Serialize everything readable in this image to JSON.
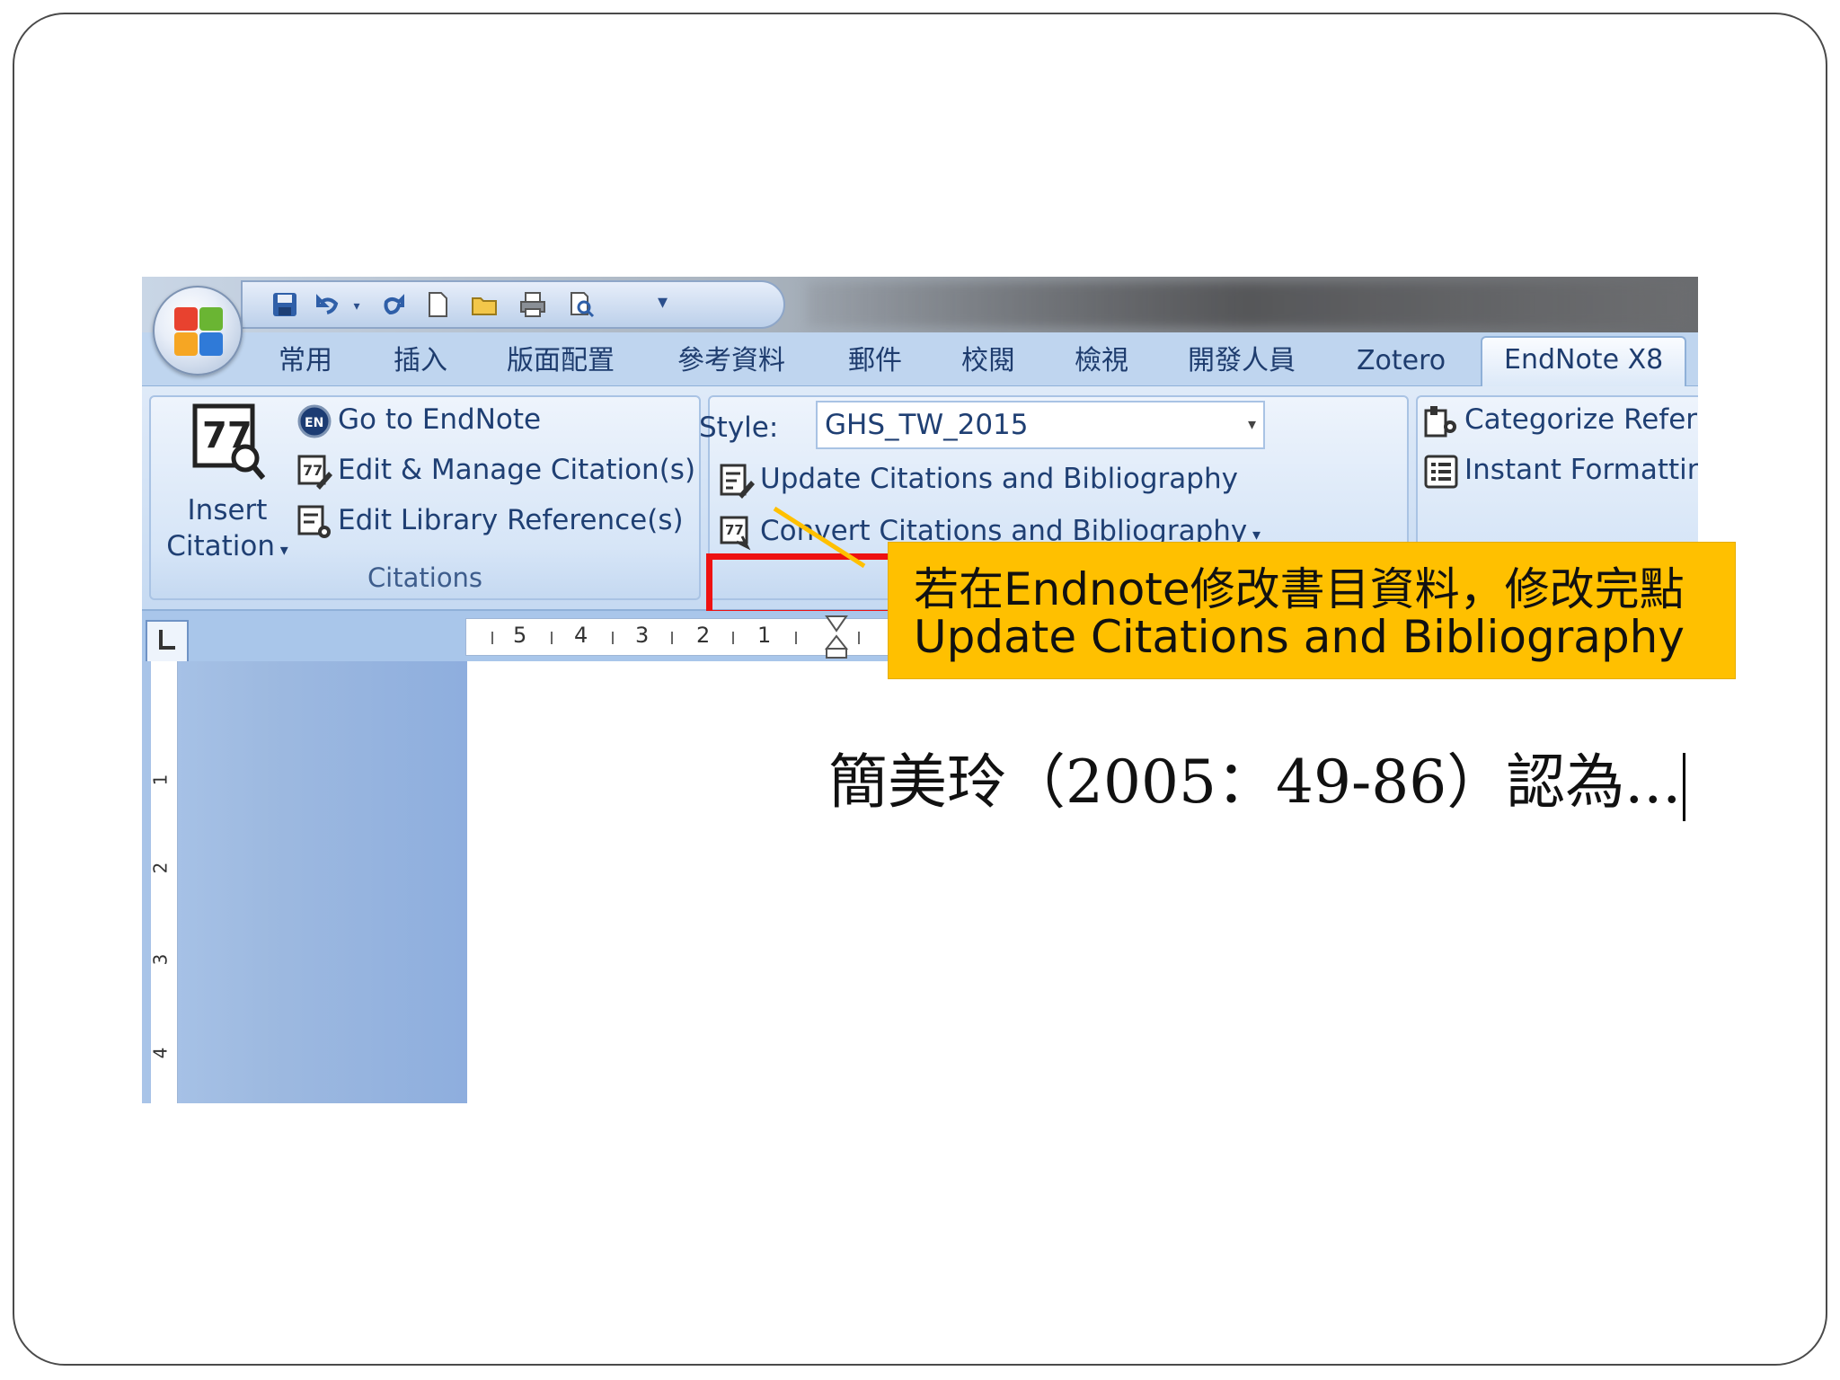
{
  "tabs": [
    "常用",
    "插入",
    "版面配置",
    "參考資料",
    "郵件",
    "校閱",
    "檢視",
    "開發人員",
    "Zotero",
    "EndNote X8"
  ],
  "citations_group": {
    "insert_label_line1": "Insert",
    "insert_label_line2": "Citation",
    "go_to_endnote": "Go to EndNote",
    "edit_manage": "Edit & Manage Citation(s)",
    "edit_library": "Edit Library Reference(s)",
    "group_label": "Citations"
  },
  "bibliography_group": {
    "style_label": "Style:",
    "style_value": "GHS_TW_2015",
    "update": "Update Citations and Bibliography",
    "convert": "Convert Citations and Bibliography"
  },
  "tools_group": {
    "categorize": "Categorize References",
    "instant_formatting": "Instant Formatting is On"
  },
  "ruler": {
    "numbers": [
      "5",
      "4",
      "3",
      "2",
      "1"
    ],
    "vertical_numbers": [
      "1",
      "2",
      "3",
      "4"
    ]
  },
  "document": {
    "text": "簡美玲（2005：49-86）認為..."
  },
  "callout": {
    "line1": "若在Endnote修改書目資料，修改完點",
    "line2": "Update Citations and Bibliography",
    "background": "#ffc000"
  },
  "colors": {
    "highlight": "#ee1111",
    "ribbon_text": "#1f3f73"
  }
}
